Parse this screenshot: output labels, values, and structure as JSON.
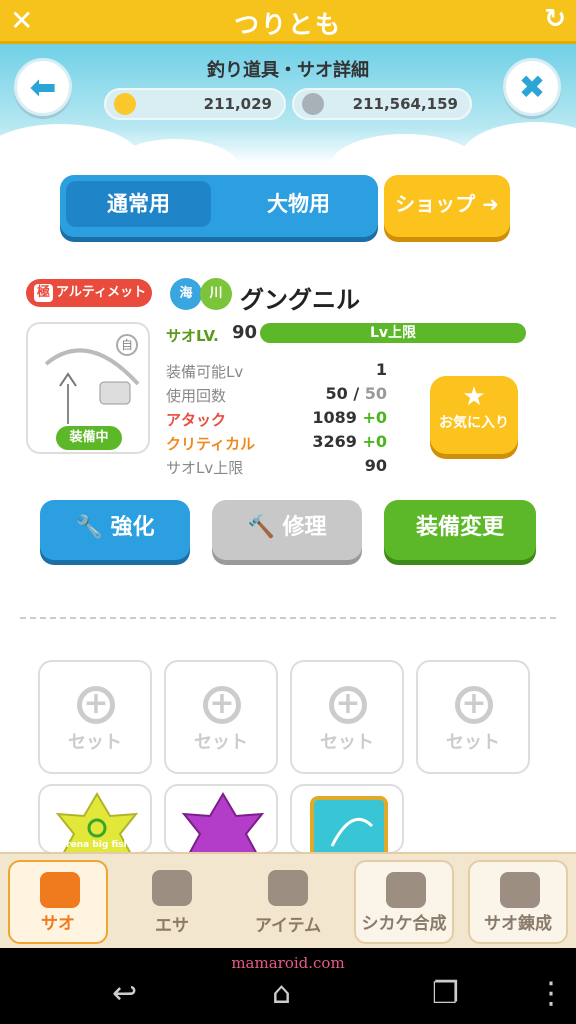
{
  "app": {
    "title": "つりとも"
  },
  "header": {
    "subtitle": "釣り道具・サオ詳細"
  },
  "currency": {
    "gems": "211,029",
    "coins": "211,564,159"
  },
  "tabs": {
    "normal": "通常用",
    "big": "大物用",
    "shop": "ショップ"
  },
  "rod": {
    "rarity_mark": "極",
    "rarity": "アルティメット",
    "type_sea": "海",
    "type_river": "川",
    "name": "グングニル",
    "equipped": "装備中",
    "auto_mark": "自",
    "lv_label": "サオLV.",
    "lv": "90",
    "lv_bar": "Lv上限",
    "stats": [
      {
        "label": "装備可能Lv",
        "value": "1",
        "bonus": ""
      },
      {
        "label": "使用回数",
        "value": "50",
        "max": "50",
        "bonus": ""
      },
      {
        "label": "アタック",
        "value": "1089",
        "bonus": "+0"
      },
      {
        "label": "クリティカル",
        "value": "3269",
        "bonus": "+0"
      },
      {
        "label": "サオLv上限",
        "value": "90",
        "bonus": ""
      }
    ],
    "favorite": "お気に入り"
  },
  "actions": {
    "enhance": "強化",
    "repair": "修理",
    "change": "装備変更"
  },
  "slots": {
    "set_label": "セット"
  },
  "items": {
    "arena_text": "arena big fish"
  },
  "nav": {
    "rod": "サオ",
    "bait": "エサ",
    "item": "アイテム",
    "combine": "シカケ合成",
    "refine": "サオ錬成"
  },
  "watermark": "mamaroid.com",
  "colors": {
    "accent": "#f6c31c",
    "blue": "#2c9fe0",
    "green": "#5cb829",
    "red": "#e94b3c"
  }
}
